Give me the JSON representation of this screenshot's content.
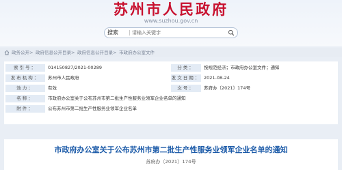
{
  "header": {
    "site_title": "苏州市人民政府",
    "site_url": "www.suzhou.gov.cn"
  },
  "search": {
    "button_label": "搜索",
    "placeholder": "请输入关键字"
  },
  "breadcrumb": [
    "政务公开",
    "政府信息公开目录",
    "政府信息公开目录",
    "市政府办公室文件"
  ],
  "info": {
    "rows": [
      {
        "l1": "索引号：",
        "v1": "014150827/2021-00289",
        "l2": "分类：",
        "v2": "按规范经济；市政府办公室文件；通知"
      },
      {
        "l1": "发布机构：",
        "v1": "苏州市人民政府",
        "l2": "发文日期：",
        "v2": "2021-08-24"
      },
      {
        "l1": "效力：",
        "v1": "有效",
        "l2": "文号：",
        "v2": "苏府办〔2021〕174号"
      },
      {
        "l1": "名称：",
        "v1": "市政府办公室关于公布苏州市第二批生产性服务业领军企业名单的通知"
      },
      {
        "l1": "附件：",
        "v1": "公布苏州市第二批生产性服务业领军企业名单"
      }
    ]
  },
  "document": {
    "title": "市政府办公室关于公布苏州市第二批生产性服务业领军企业名单的通知",
    "number": "苏府办〔2021〕174号"
  },
  "colors": {
    "title_red": "#c8102e",
    "doc_blue": "#1b5aa8"
  }
}
